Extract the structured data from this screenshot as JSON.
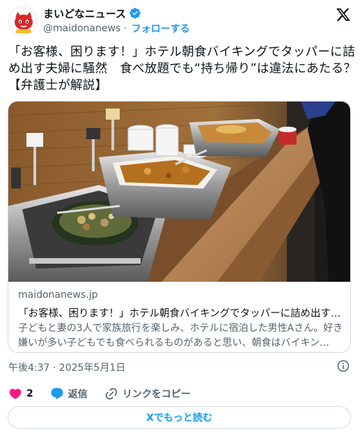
{
  "author": {
    "name": "まいどなニュース",
    "handle": "@maidonanews",
    "separator": " · ",
    "follow_label": "フォローする",
    "verified_color": "#1d9bf0"
  },
  "tweet": {
    "text": "「お客様、困ります！」ホテル朝食バイキングでタッパーに詰め出す夫婦に騒然　食べ放題でも“持ち帰り”は違法にあたる？【弁護士が解説】"
  },
  "link_card": {
    "domain": "maidonanews.jp",
    "title": "「お客様、困ります！」ホテル朝食バイキングでタッパーに詰め出す…",
    "description": "子どもと妻の3人で家族旅行を楽しみ、ホテルに宿泊した男性Aさん。好き嫌いが多い子どもでも食べられるものがあると思い、朝食はバイキン…",
    "image_icon": "hotel-buffet-photo"
  },
  "timestamp": "午後4:37 · 2025年5月1日",
  "actions": {
    "like_count": "2",
    "reply_label": "返信",
    "copy_link_label": "リンクをコピー",
    "like_color": "#f91880",
    "reply_color": "#1d9bf0"
  },
  "read_more_label": "Xでもっと読む",
  "colors": {
    "accent": "#1d9bf0",
    "text": "#0f1419",
    "muted": "#536471",
    "border": "#cfd9de"
  }
}
